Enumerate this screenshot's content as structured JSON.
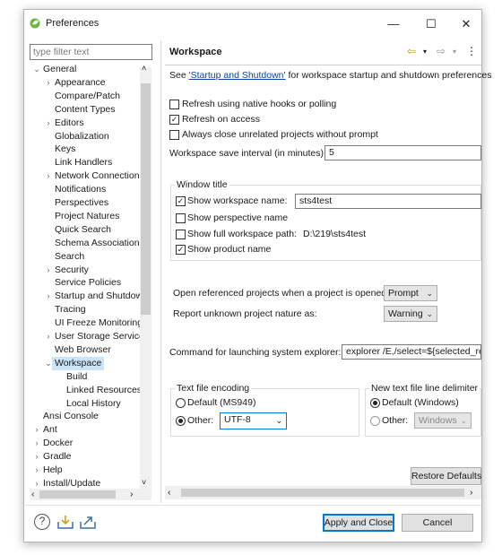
{
  "window": {
    "title": "Preferences",
    "minimize": "—",
    "maximize": "☐",
    "close": "✕"
  },
  "filter": {
    "placeholder": "type filter text"
  },
  "tree": [
    {
      "label": "General",
      "arrow": "⌄"
    },
    {
      "label": "Appearance",
      "arrow": "›"
    },
    {
      "label": "Compare/Patch",
      "arrow": ""
    },
    {
      "label": "Content Types",
      "arrow": ""
    },
    {
      "label": "Editors",
      "arrow": "›"
    },
    {
      "label": "Globalization",
      "arrow": ""
    },
    {
      "label": "Keys",
      "arrow": ""
    },
    {
      "label": "Link Handlers",
      "arrow": ""
    },
    {
      "label": "Network Connection",
      "arrow": "›"
    },
    {
      "label": "Notifications",
      "arrow": ""
    },
    {
      "label": "Perspectives",
      "arrow": ""
    },
    {
      "label": "Project Natures",
      "arrow": ""
    },
    {
      "label": "Quick Search",
      "arrow": ""
    },
    {
      "label": "Schema Associations",
      "arrow": ""
    },
    {
      "label": "Search",
      "arrow": ""
    },
    {
      "label": "Security",
      "arrow": "›"
    },
    {
      "label": "Service Policies",
      "arrow": ""
    },
    {
      "label": "Startup and Shutdown",
      "arrow": "›"
    },
    {
      "label": "Tracing",
      "arrow": ""
    },
    {
      "label": "UI Freeze Monitoring",
      "arrow": ""
    },
    {
      "label": "User Storage Service",
      "arrow": "›"
    },
    {
      "label": "Web Browser",
      "arrow": ""
    },
    {
      "label": "Workspace",
      "arrow": "⌄"
    },
    {
      "label": "Build",
      "arrow": ""
    },
    {
      "label": "Linked Resources",
      "arrow": ""
    },
    {
      "label": "Local History",
      "arrow": ""
    },
    {
      "label": "Ansi Console",
      "arrow": ""
    },
    {
      "label": "Ant",
      "arrow": "›"
    },
    {
      "label": "Docker",
      "arrow": "›"
    },
    {
      "label": "Gradle",
      "arrow": "›"
    },
    {
      "label": "Help",
      "arrow": "›"
    },
    {
      "label": "Install/Update",
      "arrow": "›"
    }
  ],
  "page": {
    "title": "Workspace",
    "nav": {
      "back": "⇦",
      "back_menu": "▾",
      "forward": "⇨",
      "forward_menu": "▾",
      "menu": "⋮"
    },
    "see_prefix": "See ",
    "see_link": "'Startup and Shutdown'",
    "see_suffix": " for workspace startup and shutdown preferences",
    "refresh_native": "Refresh using native hooks or polling",
    "refresh_access": "Refresh on access",
    "always_close": "Always close unrelated projects without prompt",
    "save_interval_label": "Workspace save interval (in minutes):",
    "save_interval_value": "5",
    "window_title_group": "Window title",
    "show_ws_name": "Show workspace name:",
    "ws_name_value": "sts4test",
    "show_perspective": "Show perspective name",
    "show_full_path": "Show full workspace path:",
    "full_path_value": "D:\\219\\sts4test",
    "show_product": "Show product name",
    "open_ref_label": "Open referenced projects when a project is opened:",
    "open_ref_value": "Prompt",
    "report_label": "Report unknown project nature as:",
    "report_value": "Warning",
    "cmd_label": "Command for launching system explorer:",
    "cmd_value": "explorer /E,/select=${selected_resource_loc}",
    "encoding_group": "Text file encoding",
    "enc_default": "Default (MS949)",
    "enc_other": "Other:",
    "enc_other_value": "UTF-8",
    "delim_group": "New text file line delimiter",
    "delim_default": "Default (Windows)",
    "delim_other": "Other:",
    "delim_other_value": "Windows",
    "restore_defaults": "Restore Defaults"
  },
  "footer": {
    "apply_close": "Apply and Close",
    "cancel": "Cancel",
    "help": "?"
  },
  "scroll": {
    "left": "‹",
    "right": "›",
    "up": "˄",
    "down": "˅"
  },
  "check": "✓",
  "colors": {
    "selection": "#cce4f7",
    "link": "#0645ad",
    "default_button_border": "#0078d7"
  }
}
